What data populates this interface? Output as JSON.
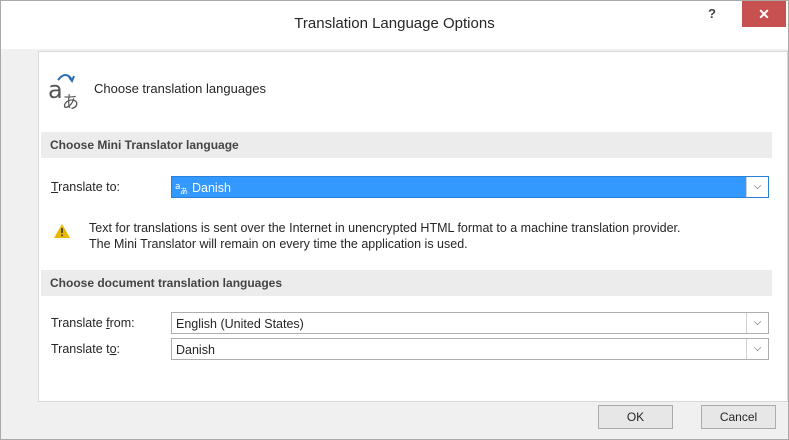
{
  "window": {
    "title": "Translation Language Options",
    "help_label": "?",
    "close_label": "✕"
  },
  "header": {
    "text": "Choose translation languages"
  },
  "mini_translator": {
    "section_title": "Choose Mini Translator language",
    "translate_to_label": {
      "u": "T",
      "rest": "ranslate to:"
    },
    "translate_to_value": "Danish",
    "warning": {
      "line1": "Text for translations is sent over the Internet in unencrypted HTML format to a machine translation provider.",
      "line2": "The Mini Translator will remain on every time the application is used."
    }
  },
  "document_translation": {
    "section_title": "Choose document translation languages",
    "from_label": {
      "pre": "Translate ",
      "u": "f",
      "rest": "rom:"
    },
    "from_value": "English (United States)",
    "to_label": {
      "pre": "Translate t",
      "u": "o",
      "rest": ":"
    },
    "to_value": "Danish"
  },
  "footer": {
    "ok_label": "OK",
    "cancel_label": "Cancel"
  },
  "colors": {
    "accent": "#3399ff",
    "close": "#c75050",
    "warning": "#e8b800"
  },
  "icons": [
    "translate-icon",
    "help-icon",
    "close-icon",
    "dropdown-arrow-icon",
    "warning-icon"
  ]
}
